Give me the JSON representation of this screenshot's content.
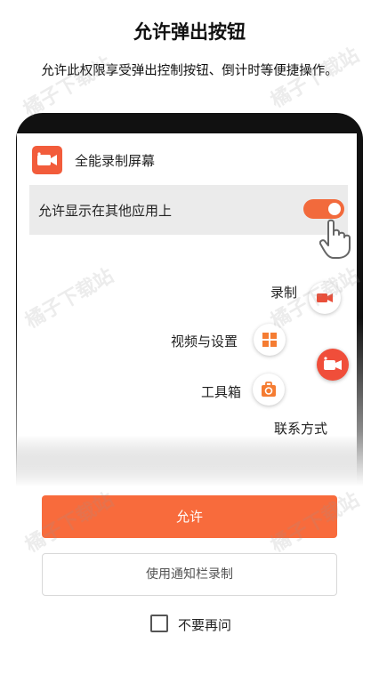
{
  "dialog": {
    "title": "允许弹出按钮",
    "description": "允许此权限享受弹出控制按钮、倒计时等便捷操作。"
  },
  "preview": {
    "app_name": "全能录制屏幕",
    "permission_label": "允许显示在其他应用上",
    "toggle_on": true,
    "floating_menu": [
      {
        "label": "录制",
        "icon": "video-camera-icon"
      },
      {
        "label": "视频与设置",
        "icon": "grid-icon"
      },
      {
        "label": "工具箱",
        "icon": "toolbox-icon"
      },
      {
        "label": "联系方式",
        "icon": "none"
      }
    ]
  },
  "actions": {
    "allow_label": "允许",
    "notification_label": "使用通知栏录制",
    "dont_ask_label": "不要再问",
    "dont_ask_checked": false
  },
  "watermark": "橘子下载站",
  "colors": {
    "accent": "#f86b3c",
    "toggle": "#f26a3c",
    "fab": "#f04e3a"
  }
}
